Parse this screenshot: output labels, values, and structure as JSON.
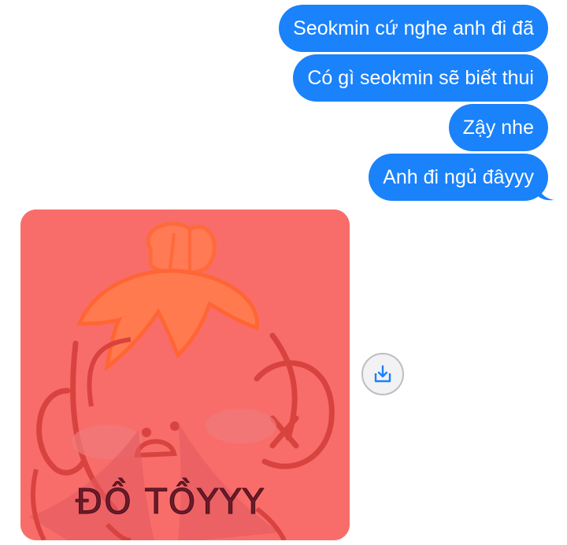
{
  "messages": [
    {
      "text": "Seokmin cứ nghe anh đi đã",
      "from": "me"
    },
    {
      "text": "Có gì seokmin sẽ biết thui",
      "from": "me"
    },
    {
      "text": "Zậy nhe",
      "from": "me"
    },
    {
      "text": "Anh đi ngủ đâyyy",
      "from": "me"
    }
  ],
  "sticker": {
    "caption": "ĐỒ TỒYYY",
    "background": "#f86d6a"
  },
  "colors": {
    "bubble": "#1a82fb",
    "bubble_text": "#ffffff",
    "icon_accent": "#1a82fb"
  },
  "icons": {
    "save": "download-tray-icon"
  }
}
